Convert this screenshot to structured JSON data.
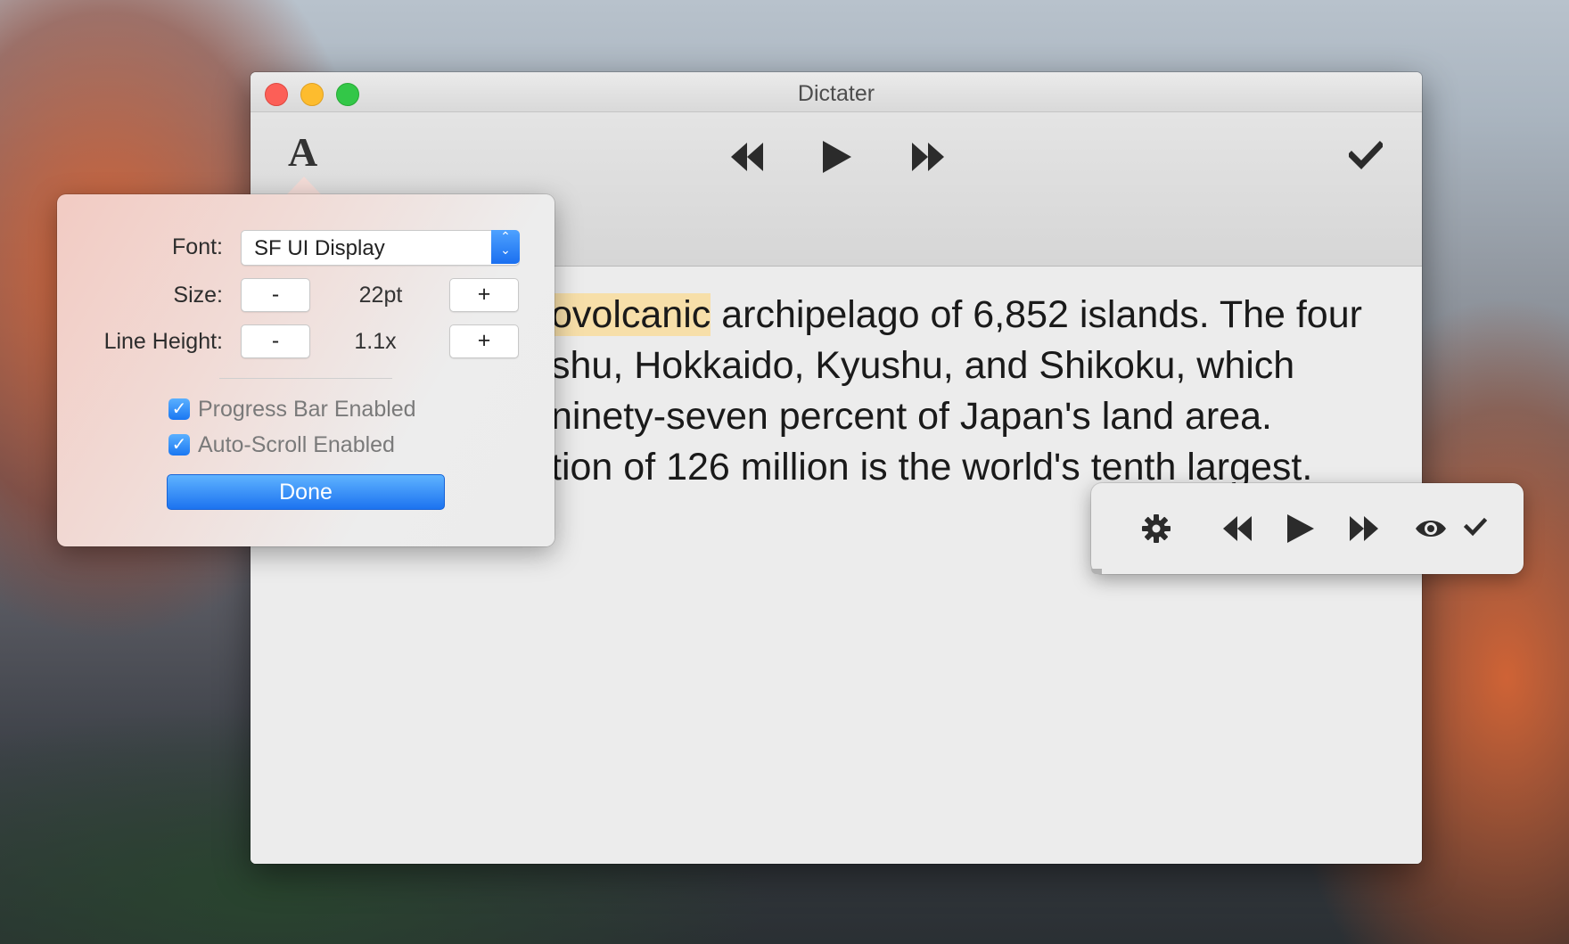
{
  "window": {
    "title": "Dictater"
  },
  "toolbar": {
    "font_icon": "font-icon",
    "font_glyph": "A",
    "rewind_icon": "rewind-icon",
    "play_icon": "play-icon",
    "forward_icon": "fast-forward-icon",
    "done_icon": "checkmark-icon"
  },
  "document": {
    "lines": [
      {
        "highlighted": "ovolcanic",
        "rest": " archipelago of 6,852 islands. The four"
      },
      {
        "text": "shu, Hokkaido, Kyushu, and Shikoku, which"
      },
      {
        "text": "ninety-seven percent of Japan's land area."
      },
      {
        "text": "tion of 126 million is the world's tenth largest."
      }
    ],
    "highlight_color": "#f7dfa9"
  },
  "popover": {
    "font_label": "Font:",
    "font_value": "SF UI Display",
    "size_label": "Size:",
    "size_value": "22pt",
    "line_height_label": "Line Height:",
    "line_height_value": "1.1x",
    "decrement_label": "-",
    "increment_label": "+",
    "progress_bar_label": "Progress Bar Enabled",
    "progress_bar_checked": true,
    "auto_scroll_label": "Auto-Scroll Enabled",
    "auto_scroll_checked": true,
    "done_label": "Done",
    "accent_color": "#1a77f2"
  },
  "mini_controller": {
    "icons": [
      "gear-icon",
      "rewind-icon",
      "play-icon",
      "fast-forward-icon",
      "eye-icon",
      "checkmark-icon"
    ]
  }
}
